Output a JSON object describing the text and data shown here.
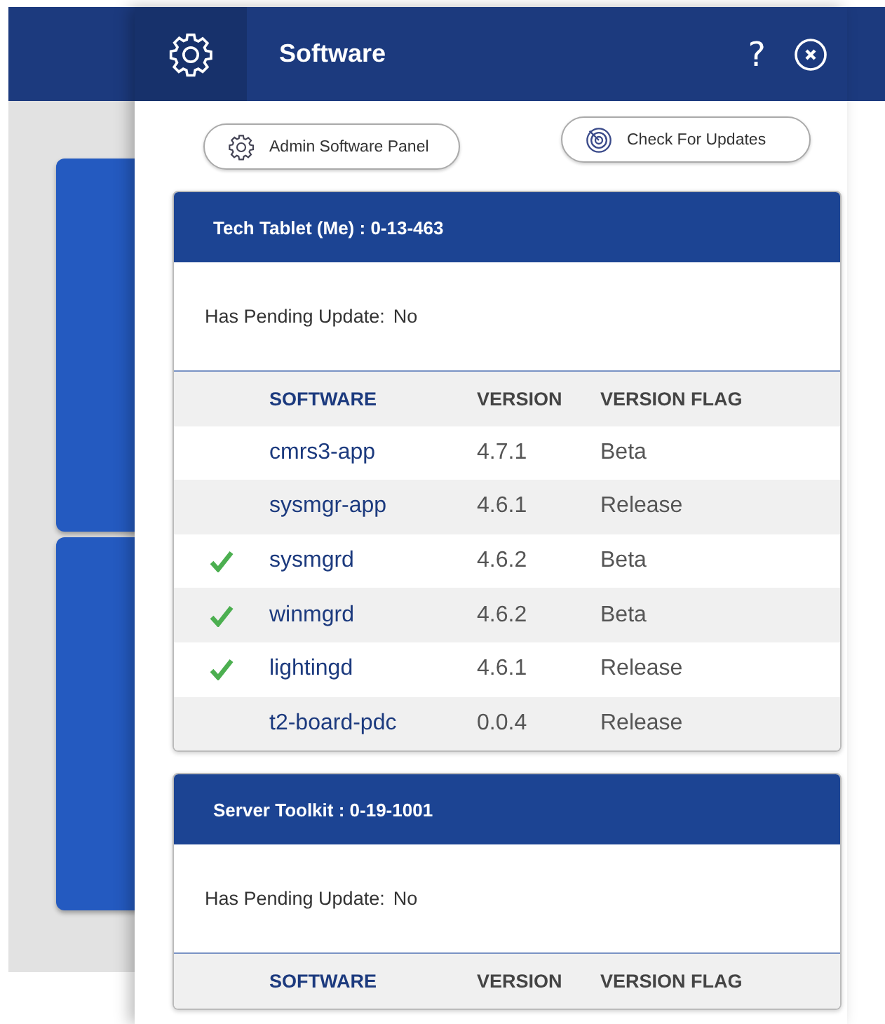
{
  "panel": {
    "title": "Software",
    "help": "?"
  },
  "actions": [
    {
      "kind": "gear",
      "label": "Admin Software Panel"
    },
    {
      "kind": "radar",
      "label": "Check For Updates"
    }
  ],
  "devices": [
    {
      "title": "Tech Tablet (Me) : 0-13-463",
      "pending_label": "Has Pending Update:",
      "pending_value": "No",
      "columns": [
        "SOFTWARE",
        "VERSION",
        "VERSION FLAG"
      ],
      "rows": [
        {
          "name": "cmrs3-app",
          "version": "4.7.1",
          "flag": "Beta",
          "checked": false
        },
        {
          "name": "sysmgr-app",
          "version": "4.6.1",
          "flag": "Release",
          "checked": false
        },
        {
          "name": "sysmgrd",
          "version": "4.6.2",
          "flag": "Beta",
          "checked": true
        },
        {
          "name": "winmgrd",
          "version": "4.6.2",
          "flag": "Beta",
          "checked": true
        },
        {
          "name": "lightingd",
          "version": "4.6.1",
          "flag": "Release",
          "checked": true
        },
        {
          "name": "t2-board-pdc",
          "version": "0.0.4",
          "flag": "Release",
          "checked": false
        }
      ]
    },
    {
      "title": "Server Toolkit : 0-19-1001",
      "pending_label": "Has Pending Update:",
      "pending_value": "No",
      "columns": [
        "SOFTWARE",
        "VERSION",
        "VERSION FLAG"
      ]
    }
  ]
}
